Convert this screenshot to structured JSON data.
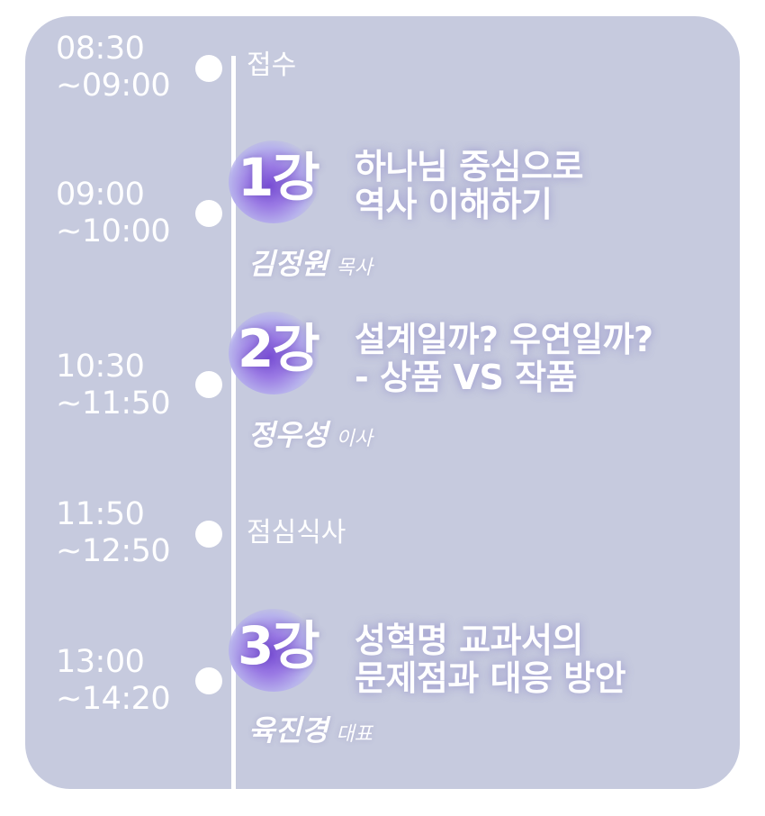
{
  "schedule": {
    "reception": {
      "time": "08:30\n~09:00",
      "label": "접수"
    },
    "lecture1": {
      "time": "09:00\n~10:00",
      "badge": "1강",
      "title": "하나님 중심으로\n역사 이해하기",
      "speaker_name": "김정원",
      "speaker_role": "목사"
    },
    "lecture2": {
      "time": "10:30\n~11:50",
      "badge": "2강",
      "title": "설계일까? 우연일까?\n- 상품 VS 작품",
      "speaker_name": "정우성",
      "speaker_role": "이사"
    },
    "lunch": {
      "time": "11:50\n~12:50",
      "label": "점심식사"
    },
    "lecture3": {
      "time": "13:00\n~14:20",
      "badge": "3강",
      "title": "성혁명 교과서의\n문제점과 대응 방안",
      "speaker_name": "육진경",
      "speaker_role": "대표"
    }
  },
  "colors": {
    "card_background": "#c6cade",
    "text": "#ffffff",
    "badge_accent": "#7a4fd6"
  }
}
